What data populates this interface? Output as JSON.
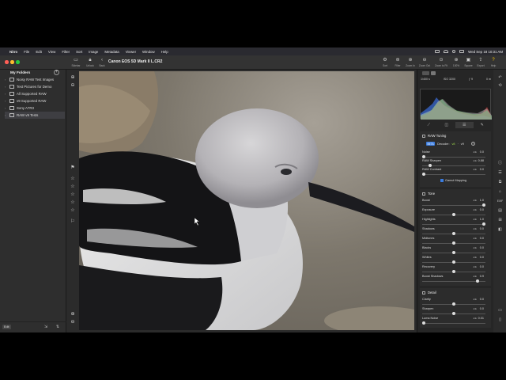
{
  "menubar": {
    "items": [
      "Nitro",
      "File",
      "Edit",
      "View",
      "Filter",
      "Sort",
      "Image",
      "Metadata",
      "Viewer",
      "Window",
      "Help"
    ],
    "clock": "Wed Sep 18  10:31 AM"
  },
  "toolbar": {
    "left_buttons": [
      {
        "label": "Sidebar"
      },
      {
        "label": "Unlock"
      },
      {
        "label": "Back"
      }
    ],
    "document_title": "Canon EOS 5D Mark II L.CR2",
    "right_buttons": [
      {
        "label": "Sort"
      },
      {
        "label": "Filter"
      },
      {
        "label": "Zoom In"
      },
      {
        "label": "Zoom Out"
      },
      {
        "label": "Zoom to Fit"
      },
      {
        "label": "100%"
      },
      {
        "label": "Square"
      },
      {
        "label": "Export"
      },
      {
        "label": "Help"
      }
    ]
  },
  "sidebar": {
    "header": "My Folders",
    "folders": [
      {
        "label": "Noisy RAW Test Images",
        "selected": false
      },
      {
        "label": "Test Pictures for Demo",
        "selected": false
      },
      {
        "label": "All Supported RAW",
        "selected": false
      },
      {
        "label": "v9 Supported RAW",
        "selected": false
      },
      {
        "label": "Sony A7R3",
        "selected": false
      },
      {
        "label": "RAW v9 Tests",
        "selected": true
      }
    ],
    "footer_badge": "Edit"
  },
  "exif": {
    "shutter": "1/400 s",
    "iso": "ISO 3200",
    "aperture": "ƒ 9",
    "focal": "0 m"
  },
  "panel": {
    "raw_tuning": {
      "title": "RAW Tuning",
      "badge": "BETA",
      "decoder_label": "Decoder:",
      "decoder_a": "v8",
      "decoder_b": "v9",
      "sliders": [
        {
          "name": "Noise",
          "value": "0.0",
          "level": 0.0
        },
        {
          "name": "RAW Sharpen",
          "value": "0.88",
          "level": 0.1
        },
        {
          "name": "RAW Contrast",
          "value": "0.0",
          "level": 0.0
        }
      ],
      "gamut_mapping": "Gamut Mapping"
    },
    "tone": {
      "title": "Tone",
      "sliders": [
        {
          "name": "Boost",
          "value": "1.0",
          "level": 1.0
        },
        {
          "name": "Exposure",
          "value": "0.0",
          "level": 0.5
        },
        {
          "name": "Highlights",
          "value": "1.0",
          "level": 1.0
        },
        {
          "name": "Shadows",
          "value": "0.0",
          "level": 0.5
        },
        {
          "name": "Midtones",
          "value": "0.0",
          "level": 0.5
        },
        {
          "name": "Blacks",
          "value": "0.0",
          "level": 0.5
        },
        {
          "name": "Whites",
          "value": "0.0",
          "level": 0.5
        },
        {
          "name": "Recovery",
          "value": "0.0",
          "level": 0.5
        },
        {
          "name": "Boost Shadows",
          "value": "0.9",
          "level": 0.9
        }
      ]
    },
    "detail": {
      "title": "Detail",
      "sliders": [
        {
          "name": "Clarity",
          "value": "0.0",
          "level": 0.5
        },
        {
          "name": "Sharpen",
          "value": "0.0",
          "level": 0.5
        },
        {
          "name": "Luma Noise",
          "value": "0.01",
          "level": 0.0
        }
      ]
    }
  },
  "colors": {
    "accent": "#3b7de0",
    "traffic_red": "#ff5f57",
    "traffic_yellow": "#febc2e",
    "traffic_green": "#28c840"
  }
}
